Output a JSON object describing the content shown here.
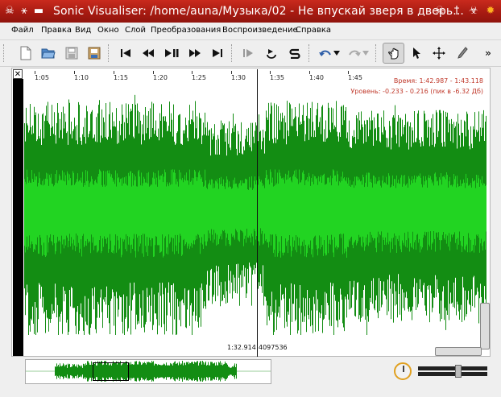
{
  "window": {
    "title": "Sonic Visualiser: /home/auna/Музыка/02 - Не впускай зверя в дверь...",
    "titlebar_icons": [
      "pin-icon",
      "minimize-icon",
      "restore-icon"
    ],
    "titlebar_right_icons": [
      "skull-icon",
      "dagger-icon",
      "biohazard-icon",
      "flame-icon"
    ]
  },
  "menu": {
    "items": [
      "Файл",
      "Правка",
      "Вид",
      "Окно",
      "Слой",
      "Преобразования",
      "Воспроизведение",
      "Справка"
    ]
  },
  "toolbar": {
    "file_buttons": [
      "new-icon",
      "open-icon",
      "save-icon",
      "export-icon"
    ],
    "transport_buttons": [
      "rewind-start-icon",
      "rewind-icon",
      "play-pause-icon",
      "fast-forward-icon",
      "fast-forward-end-icon"
    ],
    "playback_mode_buttons": [
      "select-play-icon",
      "loop-icon",
      "solo-icon"
    ],
    "edit_buttons": [
      "undo-icon",
      "redo-icon"
    ],
    "tool_buttons": [
      "navigate-icon",
      "select-icon",
      "move-icon",
      "draw-icon"
    ],
    "overflow": "»"
  },
  "ruler": {
    "ticks": [
      "1:05",
      "1:10",
      "1:15",
      "1:20",
      "1:25",
      "1:30",
      "1:35",
      "1:40",
      "1:45"
    ]
  },
  "info": {
    "time": "Время: 1:42.987 - 1:43.118",
    "level": "Уровень: -0.233 - 0.216 (пик в -6.32 Дб)"
  },
  "playhead": {
    "time": "1:32.914",
    "frame": "4097536"
  },
  "colors": {
    "waveform_outer": "#138d13",
    "waveform_inner": "#22d422",
    "titlebar": "#b7221a",
    "info_text": "#c0392b"
  }
}
